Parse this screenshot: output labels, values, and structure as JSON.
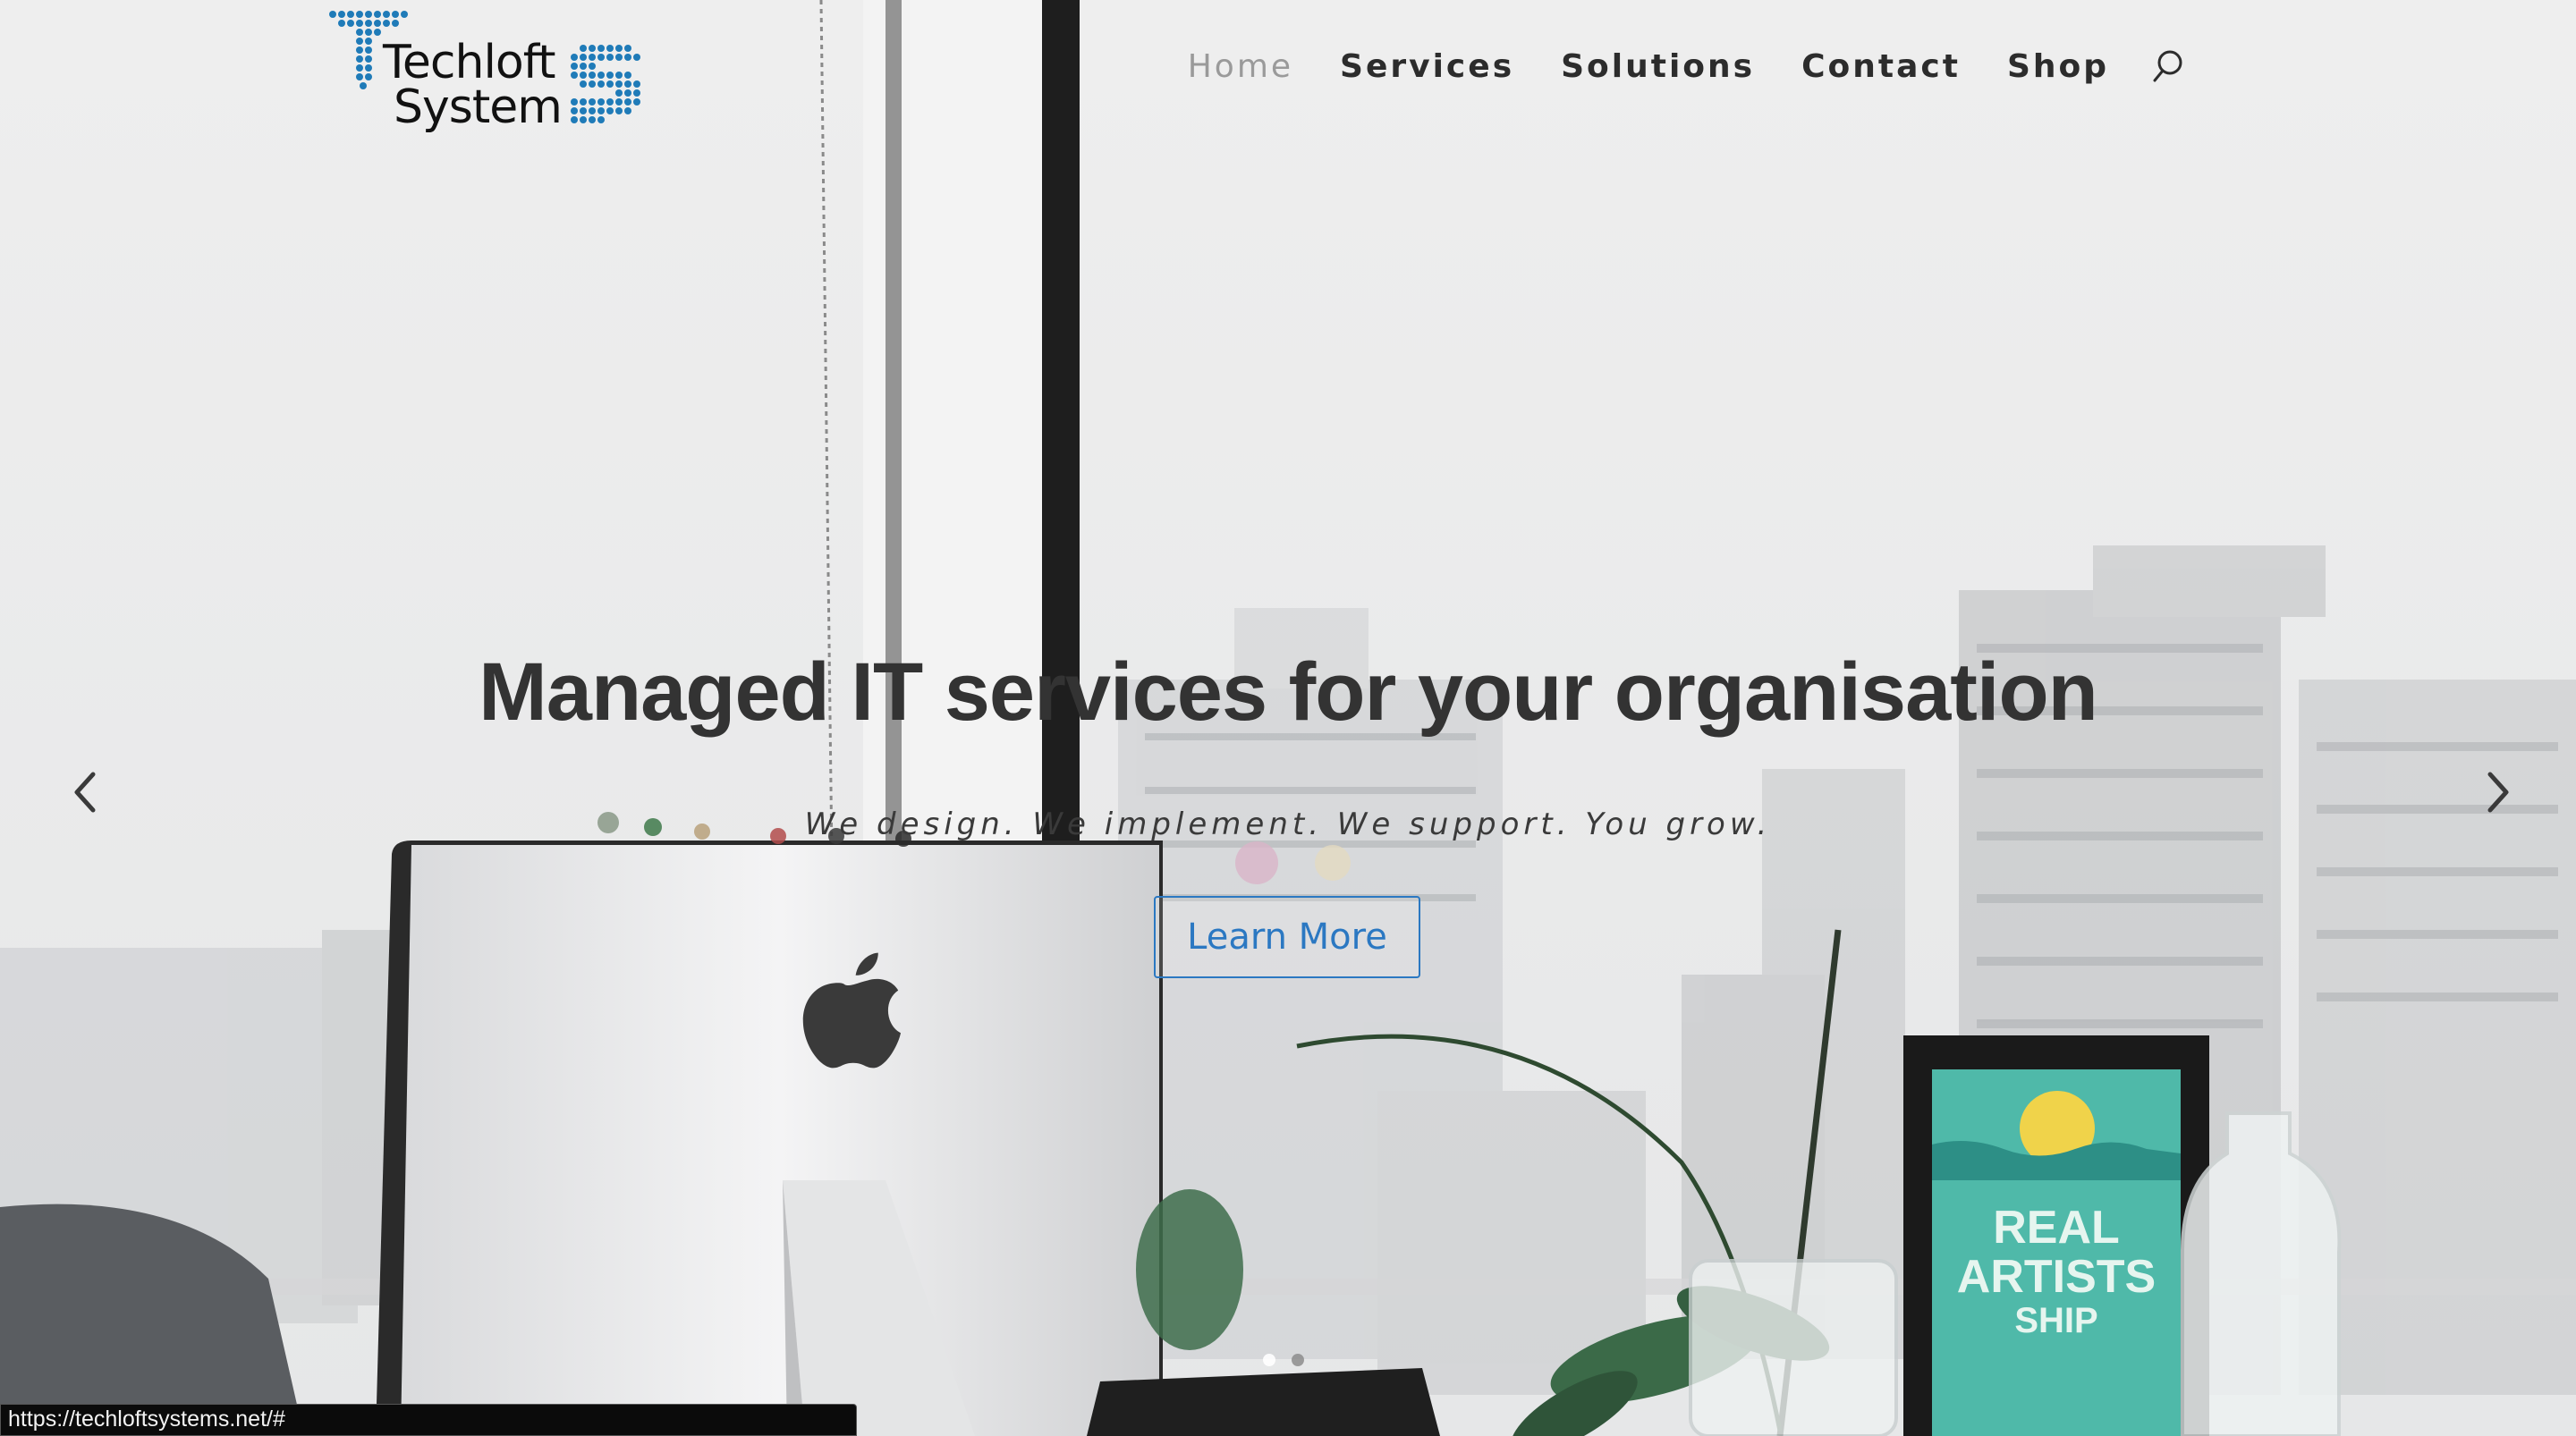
{
  "logo": {
    "line1": "Techloft",
    "line2": "System",
    "accent_color": "#1f7bb8"
  },
  "nav": {
    "items": [
      {
        "label": "Home",
        "active": true
      },
      {
        "label": "Services",
        "active": false
      },
      {
        "label": "Solutions",
        "active": false
      },
      {
        "label": "Contact",
        "active": false
      },
      {
        "label": "Shop",
        "active": false
      }
    ],
    "search_icon": "search-icon"
  },
  "hero": {
    "title": "Managed IT services for your organisation",
    "subtitle": "We design. We implement. We support. You grow.",
    "button_label": "Learn More",
    "button_color": "#2b78c2",
    "poster_lines": [
      "REAL",
      "ARTISTS",
      "SHIP"
    ]
  },
  "slider": {
    "prev_icon": "chevron-left-icon",
    "next_icon": "chevron-right-icon",
    "slide_count": 2,
    "active_slide": 1
  },
  "status_bar": {
    "url": "https://techloftsystems.net/#"
  }
}
